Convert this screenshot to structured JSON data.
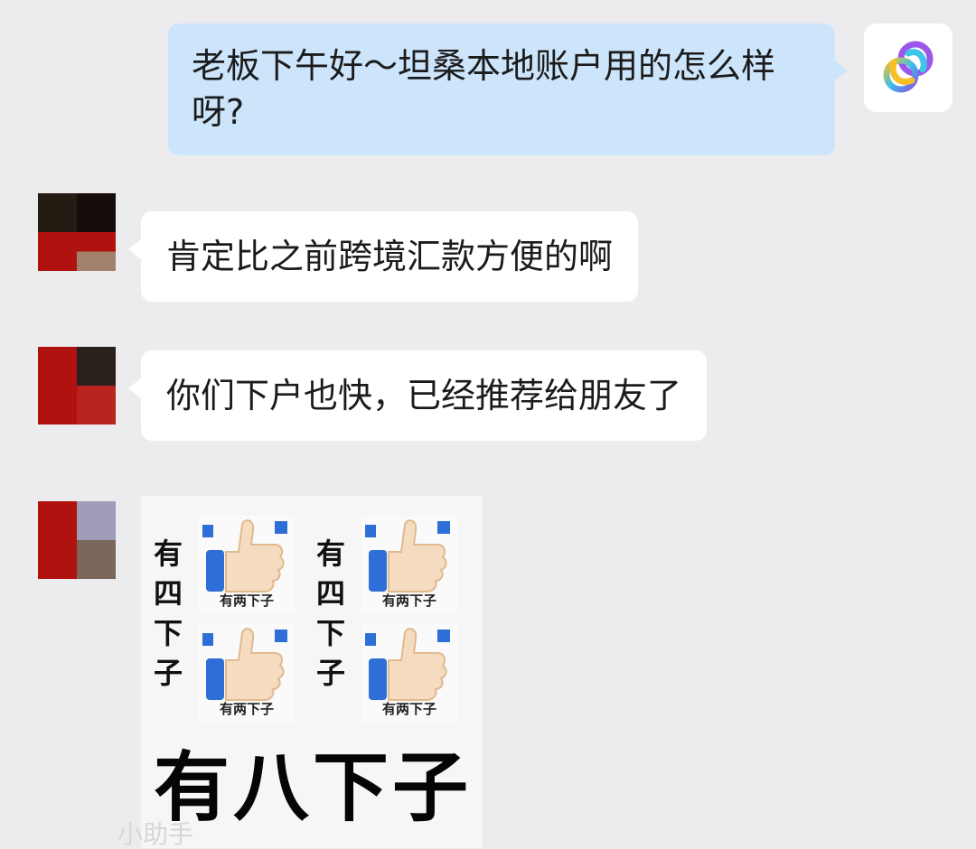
{
  "messages": {
    "outgoing": {
      "text": "老板下午好～坦桑本地账户用的怎么样呀?"
    },
    "incoming_1": {
      "text": "肯定比之前跨境汇款方便的啊"
    },
    "incoming_2": {
      "text": "你们下户也快，已经推荐给朋友了"
    },
    "sticker": {
      "left_column": [
        "有",
        "四",
        "下",
        "子"
      ],
      "right_column": [
        "有",
        "四",
        "下",
        "子"
      ],
      "thumb_caption": "有两下子",
      "big_caption": "有八下子"
    }
  },
  "watermark": "小助手",
  "colors": {
    "outgoing_bubble": "#cde5fb",
    "incoming_bubble": "#ffffff",
    "background": "#ececee",
    "avatar_red": "#b0120f"
  },
  "icons": {
    "self_avatar": "loop-logo-icon",
    "thumbs": "thumbs-up-icon"
  }
}
